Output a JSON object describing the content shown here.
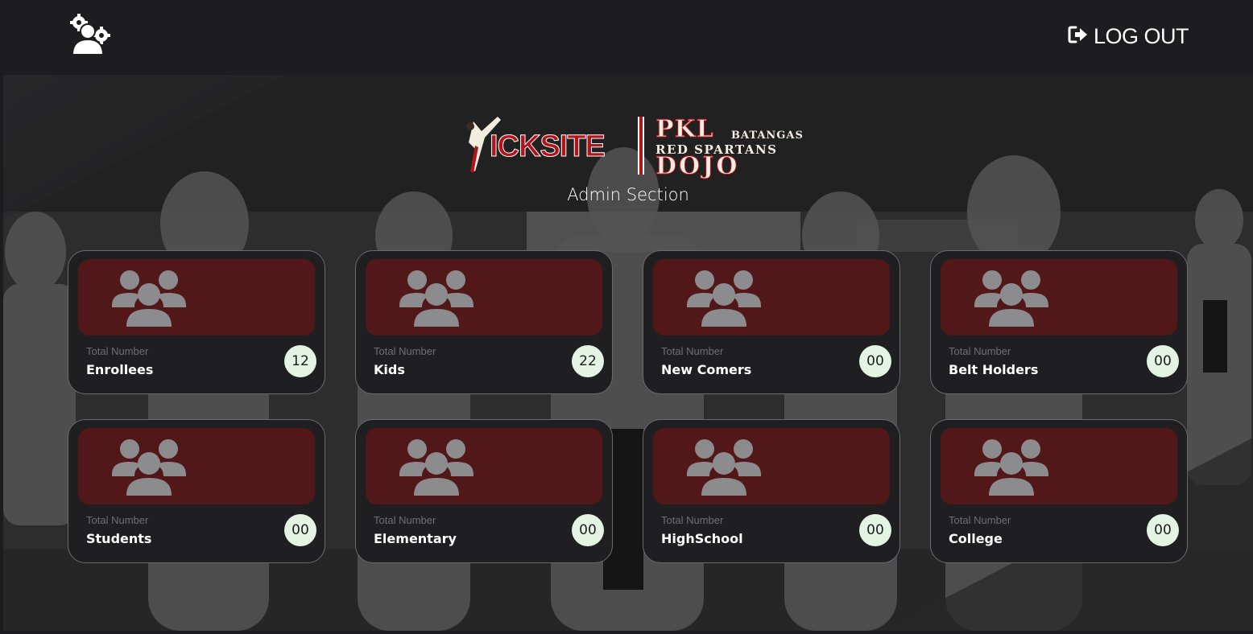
{
  "header": {
    "admin_icon": "admin-users-gear-icon",
    "logout_icon": "sign-out-icon",
    "logout_label": "LOG OUT"
  },
  "logo": {
    "left_text": "ICKSITE",
    "pkl": "PKL",
    "batangas": "BATANGAS",
    "red_spartans": "RED SPARTANS",
    "dojo": "DOJO"
  },
  "page": {
    "section_title": "Admin Section"
  },
  "colors": {
    "accent_red": "#b5131a",
    "card_banner": "#521718",
    "count_badge": "#e4f3e4"
  },
  "cards": [
    {
      "caption": "Total Number",
      "title": "Enrollees",
      "count": "12",
      "icon": "users-group-icon"
    },
    {
      "caption": "Total Number",
      "title": "Kids",
      "count": "22",
      "icon": "users-group-icon"
    },
    {
      "caption": "Total Number",
      "title": "New Comers",
      "count": "00",
      "icon": "users-group-icon"
    },
    {
      "caption": "Total Number",
      "title": "Belt Holders",
      "count": "00",
      "icon": "users-group-icon"
    },
    {
      "caption": "Total Number",
      "title": "Students",
      "count": "00",
      "icon": "users-group-icon"
    },
    {
      "caption": "Total Number",
      "title": "Elementary",
      "count": "00",
      "icon": "users-group-icon"
    },
    {
      "caption": "Total Number",
      "title": "HighSchool",
      "count": "00",
      "icon": "users-group-icon"
    },
    {
      "caption": "Total Number",
      "title": "College",
      "count": "00",
      "icon": "users-group-icon"
    }
  ]
}
